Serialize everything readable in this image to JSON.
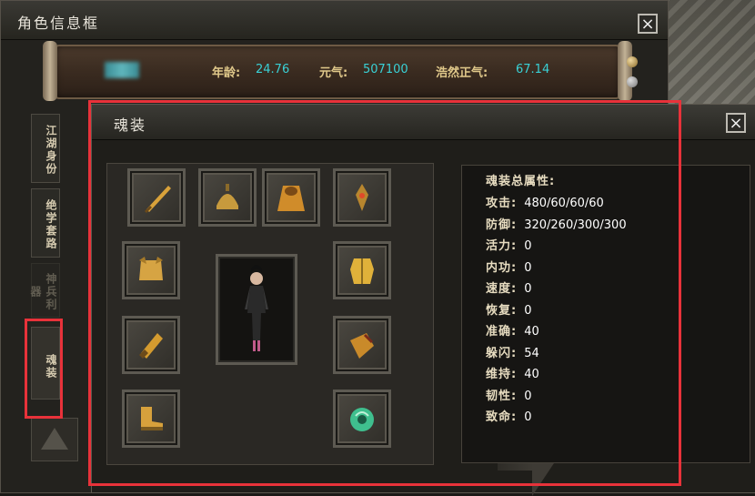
{
  "back_window": {
    "title": "角色信息框",
    "close_label": "×",
    "stats": [
      {
        "label": "年龄:",
        "value": "24.76"
      },
      {
        "label": "元气:",
        "value": "507100"
      },
      {
        "label": "浩然正气:",
        "value": "67.14"
      }
    ],
    "side_tabs": [
      "江湖身份",
      "绝学套路",
      "神兵利器",
      "魂装"
    ]
  },
  "front_window": {
    "title": "魂装",
    "close_label": "×",
    "slots": [
      {
        "icon": "dagger-icon",
        "color": "#d9a23a"
      },
      {
        "icon": "helmet-icon",
        "color": "#c79a3d"
      },
      {
        "icon": "cape-icon",
        "color": "#d08c2a"
      },
      {
        "icon": "amulet-icon",
        "color": "#b8862e"
      },
      {
        "icon": "armor-icon",
        "color": "#d6a443"
      },
      {
        "icon": "chest-armor-icon",
        "color": "#e0b13a"
      },
      {
        "icon": "bracer-icon",
        "color": "#d49b2f"
      },
      {
        "icon": "gauntlet-icon",
        "color": "#c98a2a"
      },
      {
        "icon": "boots-icon",
        "color": "#d7a13c"
      },
      {
        "icon": "jade-pendant-icon",
        "color": "#3fbf8e"
      }
    ],
    "attributes": {
      "title": "魂装总属性:",
      "rows": [
        {
          "label": "攻击:",
          "value": "480/60/60/60"
        },
        {
          "label": "防御:",
          "value": "320/260/300/300"
        },
        {
          "label": "活力:",
          "value": "0"
        },
        {
          "label": "内功:",
          "value": "0"
        },
        {
          "label": "速度:",
          "value": "0"
        },
        {
          "label": "恢复:",
          "value": "0"
        },
        {
          "label": "准确:",
          "value": "40"
        },
        {
          "label": "躲闪:",
          "value": "54"
        },
        {
          "label": "维持:",
          "value": "40"
        },
        {
          "label": "韧性:",
          "value": "0"
        },
        {
          "label": "致命:",
          "value": "0"
        }
      ]
    }
  },
  "highlight_color": "#e8323a"
}
